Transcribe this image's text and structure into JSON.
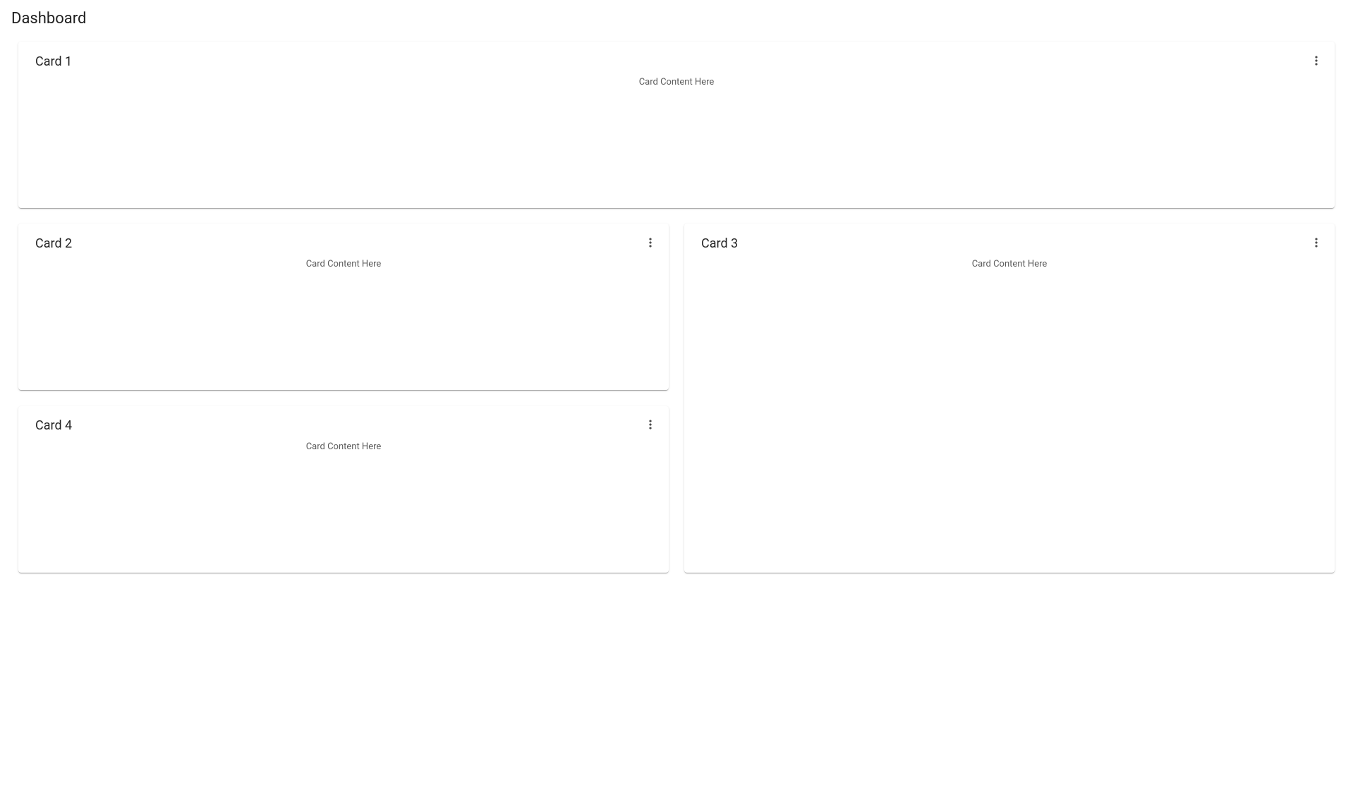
{
  "page": {
    "title": "Dashboard"
  },
  "cards": [
    {
      "title": "Card 1",
      "content": "Card Content Here"
    },
    {
      "title": "Card 2",
      "content": "Card Content Here"
    },
    {
      "title": "Card 3",
      "content": "Card Content Here"
    },
    {
      "title": "Card 4",
      "content": "Card Content Here"
    }
  ]
}
